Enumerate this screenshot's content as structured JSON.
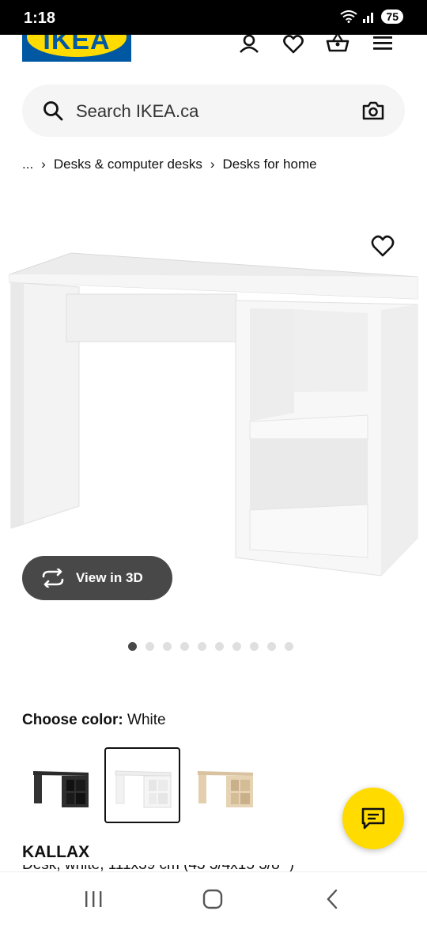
{
  "status_bar": {
    "time": "1:18",
    "battery": "75"
  },
  "header": {
    "logo_text": "IKEA",
    "icons": [
      "user-icon",
      "heart-icon",
      "basket-icon",
      "menu-icon"
    ]
  },
  "search": {
    "placeholder": "Search IKEA.ca",
    "value": ""
  },
  "breadcrumb": {
    "ellipsis": "...",
    "items": [
      "Desks & computer desks",
      "Desks for home"
    ]
  },
  "gallery": {
    "view3d_label": "View in 3D",
    "dot_count": 10,
    "active_index": 0
  },
  "color": {
    "label": "Choose color:",
    "selected": "White",
    "swatches": [
      "black-brown",
      "white",
      "white-stained-oak"
    ]
  },
  "product": {
    "name": "KALLAX",
    "description": "Desk, white, 111x39 cm (43 3/4x15 3/8 \")"
  },
  "colors": {
    "brand_blue": "#0058a3",
    "brand_yellow": "#ffdb00",
    "button_dark": "#484848"
  }
}
